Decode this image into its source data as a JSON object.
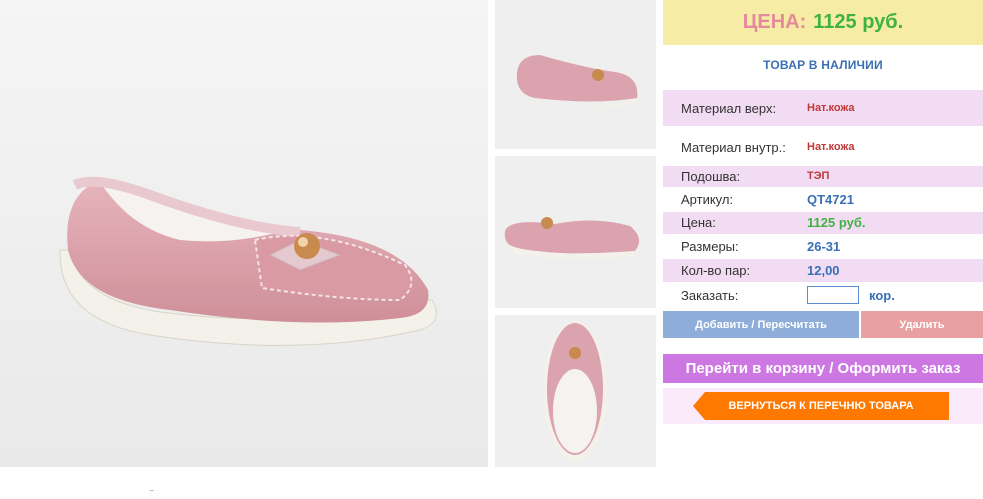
{
  "product": {
    "main_image_icon": "pink-loafer-shoe-photo",
    "thumbnails": [
      {
        "icon": "pink-loafer-side-view"
      },
      {
        "icon": "pink-loafer-angle-view"
      },
      {
        "icon": "pink-loafer-top-view"
      }
    ]
  },
  "price_box": {
    "label": "ЦЕНА:",
    "value": "1125 руб."
  },
  "stock_status": "ТОВАР В НАЛИЧИИ",
  "specs": [
    {
      "key": "Материал верх:",
      "value": "Нат.кожа"
    },
    {
      "key": "Материал внутр.:",
      "value": "Нат.кожа"
    },
    {
      "key": "Подошва:",
      "value": "ТЭП"
    },
    {
      "key": "Артикул:",
      "value": "QT4721"
    },
    {
      "key": "Цена:",
      "value": "1125 руб."
    },
    {
      "key": "Размеры:",
      "value": "26-31"
    },
    {
      "key": "Кол-во пар:",
      "value": "12,00"
    }
  ],
  "order": {
    "label": "Заказать:",
    "quantity_value": "",
    "unit": "кор."
  },
  "buttons": {
    "recalc": "Добавить / Пересчитать",
    "delete": "Удалить",
    "cart": "Перейти в корзину / Оформить заказ",
    "back": "ВЕРНУТЬСЯ К ПЕРЕЧНЮ ТОВАРА"
  },
  "colors": {
    "price_bg": "#f6eca5",
    "price_label": "#e58a9a",
    "price_value": "#3fb33f",
    "stock_text": "#3a6fb5",
    "spec_row_pink": "#f2dcf3",
    "recalc_button": "#8eadd9",
    "delete_button": "#e8a0a0",
    "cart_button": "#cc77e2",
    "back_button": "#ff7800"
  }
}
